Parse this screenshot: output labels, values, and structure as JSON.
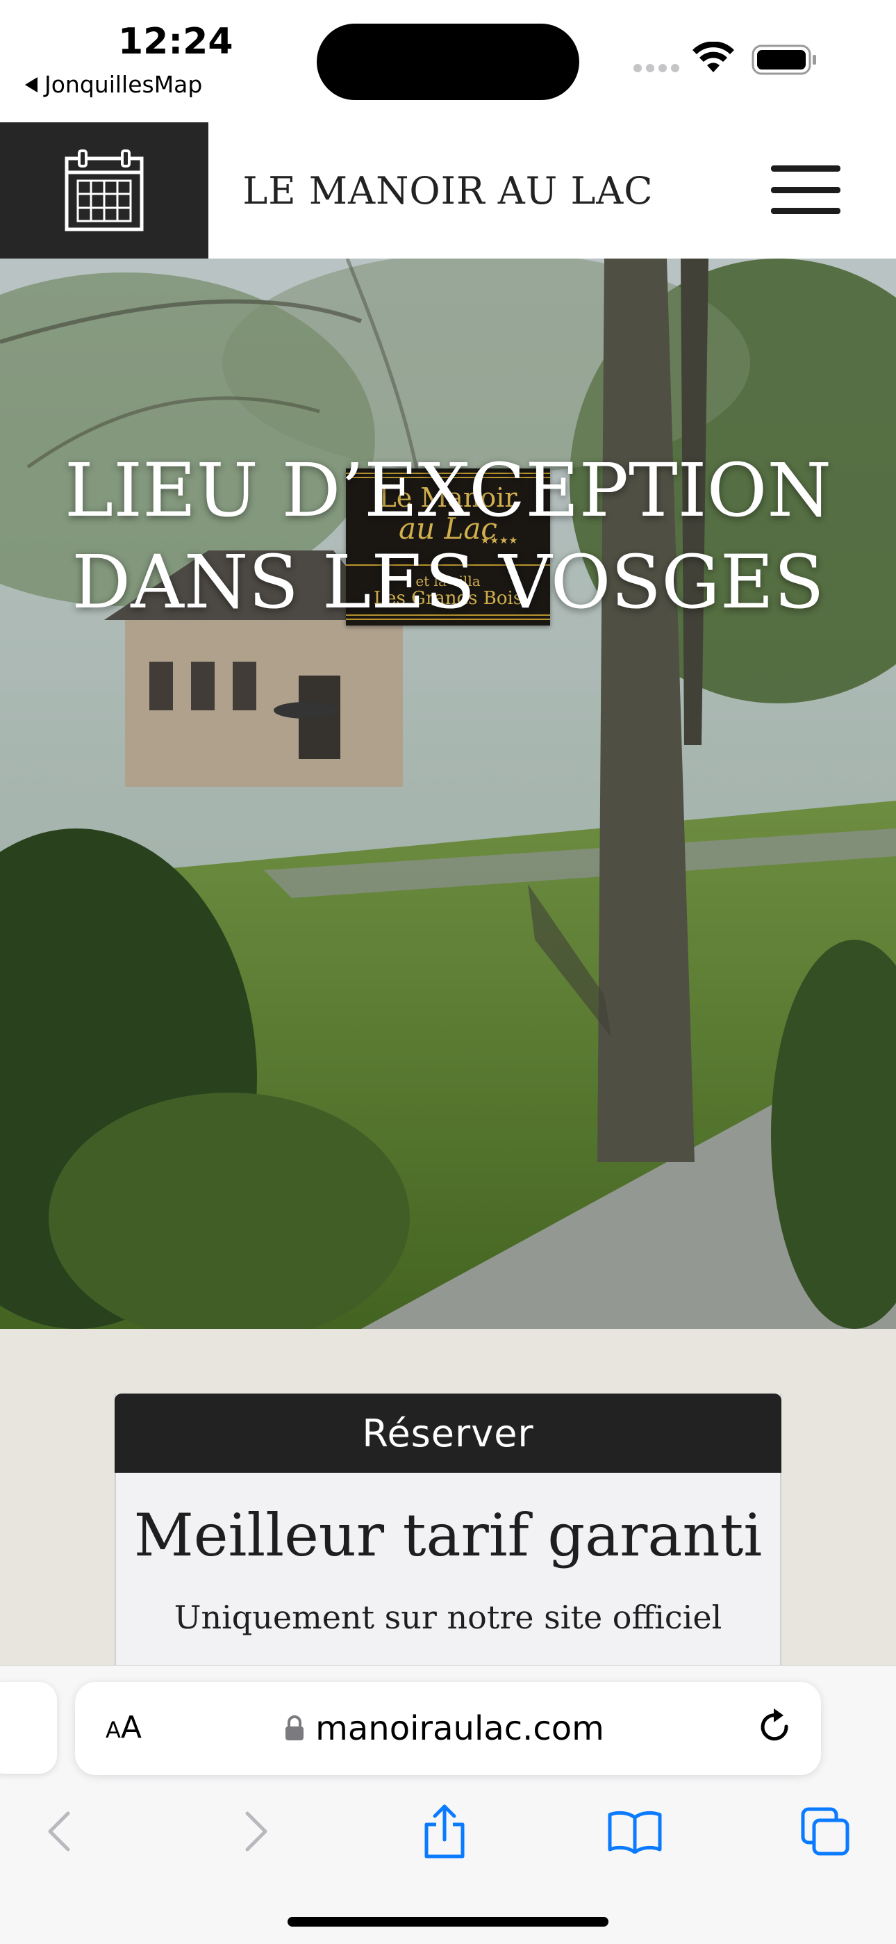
{
  "status_bar": {
    "time": "12:24",
    "back_app": "JonquillesMap"
  },
  "header": {
    "brand": "LE MANOIR AU LAC",
    "calendar_icon": "calendar-icon",
    "menu_icon": "hamburger-menu-icon"
  },
  "hero": {
    "logo": {
      "line1": "Le Manoir",
      "line2": "au Lac",
      "stars": "★★★★",
      "line3": "et la villa",
      "line4": "Les Grands Bois"
    },
    "heading": "LIEU D’EXCEPTION DANS LES VOSGES"
  },
  "booking": {
    "tab_label": "Réserver",
    "title": "Meilleur tarif garanti",
    "subtitle": "Uniquement sur notre site officiel"
  },
  "browser": {
    "text_size_small": "A",
    "text_size_large": "A",
    "url": "manoiraulac.com",
    "colors": {
      "link_blue": "#0a7aff",
      "disabled_gray": "#b8b8bd"
    }
  }
}
